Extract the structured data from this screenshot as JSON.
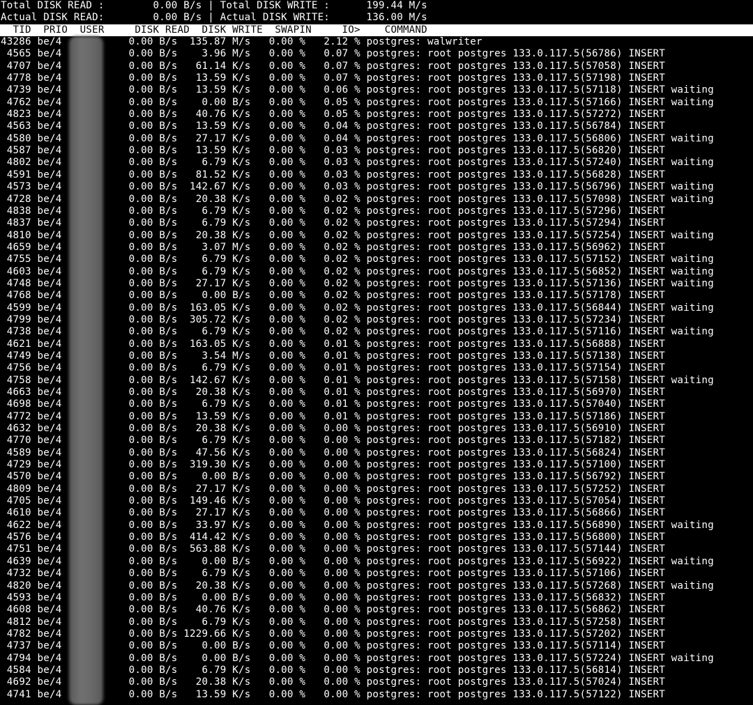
{
  "summary": {
    "total_line": "Total DISK READ :        0.00 B/s | Total DISK WRITE :      199.44 M/s",
    "actual_line": "Actual DISK READ:        0.00 B/s | Actual DISK WRITE:      136.00 M/s"
  },
  "columns": {
    "header_line": "  TID  PRIO  USER     DISK READ  DISK WRITE  SWAPIN     IO>    COMMAND"
  },
  "rows": [
    {
      "tid": "43286",
      "prio": "be/4",
      "read": "0.00 B/s",
      "write": "135.87 M/s",
      "swapin": "0.00 %",
      "io": "2.12 %",
      "cmd": "postgres: walwriter"
    },
    {
      "tid": "4565",
      "prio": "be/4",
      "read": "0.00 B/s",
      "write": "3.96 M/s",
      "swapin": "0.00 %",
      "io": "0.07 %",
      "cmd": "postgres: root postgres 133.0.117.5(56786) INSERT"
    },
    {
      "tid": "4707",
      "prio": "be/4",
      "read": "0.00 B/s",
      "write": "61.14 K/s",
      "swapin": "0.00 %",
      "io": "0.07 %",
      "cmd": "postgres: root postgres 133.0.117.5(57058) INSERT"
    },
    {
      "tid": "4778",
      "prio": "be/4",
      "read": "0.00 B/s",
      "write": "13.59 K/s",
      "swapin": "0.00 %",
      "io": "0.07 %",
      "cmd": "postgres: root postgres 133.0.117.5(57198) INSERT"
    },
    {
      "tid": "4739",
      "prio": "be/4",
      "read": "0.00 B/s",
      "write": "13.59 K/s",
      "swapin": "0.00 %",
      "io": "0.06 %",
      "cmd": "postgres: root postgres 133.0.117.5(57118) INSERT waiting"
    },
    {
      "tid": "4762",
      "prio": "be/4",
      "read": "0.00 B/s",
      "write": "0.00 B/s",
      "swapin": "0.00 %",
      "io": "0.05 %",
      "cmd": "postgres: root postgres 133.0.117.5(57166) INSERT waiting"
    },
    {
      "tid": "4823",
      "prio": "be/4",
      "read": "0.00 B/s",
      "write": "40.76 K/s",
      "swapin": "0.00 %",
      "io": "0.05 %",
      "cmd": "postgres: root postgres 133.0.117.5(57272) INSERT"
    },
    {
      "tid": "4563",
      "prio": "be/4",
      "read": "0.00 B/s",
      "write": "13.59 K/s",
      "swapin": "0.00 %",
      "io": "0.04 %",
      "cmd": "postgres: root postgres 133.0.117.5(56784) INSERT"
    },
    {
      "tid": "4580",
      "prio": "be/4",
      "read": "0.00 B/s",
      "write": "27.17 K/s",
      "swapin": "0.00 %",
      "io": "0.04 %",
      "cmd": "postgres: root postgres 133.0.117.5(56806) INSERT waiting"
    },
    {
      "tid": "4587",
      "prio": "be/4",
      "read": "0.00 B/s",
      "write": "13.59 K/s",
      "swapin": "0.00 %",
      "io": "0.03 %",
      "cmd": "postgres: root postgres 133.0.117.5(56820) INSERT"
    },
    {
      "tid": "4802",
      "prio": "be/4",
      "read": "0.00 B/s",
      "write": "6.79 K/s",
      "swapin": "0.00 %",
      "io": "0.03 %",
      "cmd": "postgres: root postgres 133.0.117.5(57240) INSERT waiting"
    },
    {
      "tid": "4591",
      "prio": "be/4",
      "read": "0.00 B/s",
      "write": "81.52 K/s",
      "swapin": "0.00 %",
      "io": "0.03 %",
      "cmd": "postgres: root postgres 133.0.117.5(56828) INSERT"
    },
    {
      "tid": "4573",
      "prio": "be/4",
      "read": "0.00 B/s",
      "write": "142.67 K/s",
      "swapin": "0.00 %",
      "io": "0.03 %",
      "cmd": "postgres: root postgres 133.0.117.5(56796) INSERT waiting"
    },
    {
      "tid": "4728",
      "prio": "be/4",
      "read": "0.00 B/s",
      "write": "20.38 K/s",
      "swapin": "0.00 %",
      "io": "0.02 %",
      "cmd": "postgres: root postgres 133.0.117.5(57098) INSERT waiting"
    },
    {
      "tid": "4838",
      "prio": "be/4",
      "read": "0.00 B/s",
      "write": "6.79 K/s",
      "swapin": "0.00 %",
      "io": "0.02 %",
      "cmd": "postgres: root postgres 133.0.117.5(57296) INSERT"
    },
    {
      "tid": "4837",
      "prio": "be/4",
      "read": "0.00 B/s",
      "write": "6.79 K/s",
      "swapin": "0.00 %",
      "io": "0.02 %",
      "cmd": "postgres: root postgres 133.0.117.5(57294) INSERT"
    },
    {
      "tid": "4810",
      "prio": "be/4",
      "read": "0.00 B/s",
      "write": "20.38 K/s",
      "swapin": "0.00 %",
      "io": "0.02 %",
      "cmd": "postgres: root postgres 133.0.117.5(57254) INSERT waiting"
    },
    {
      "tid": "4659",
      "prio": "be/4",
      "read": "0.00 B/s",
      "write": "3.07 M/s",
      "swapin": "0.00 %",
      "io": "0.02 %",
      "cmd": "postgres: root postgres 133.0.117.5(56962) INSERT"
    },
    {
      "tid": "4755",
      "prio": "be/4",
      "read": "0.00 B/s",
      "write": "6.79 K/s",
      "swapin": "0.00 %",
      "io": "0.02 %",
      "cmd": "postgres: root postgres 133.0.117.5(57152) INSERT waiting"
    },
    {
      "tid": "4603",
      "prio": "be/4",
      "read": "0.00 B/s",
      "write": "6.79 K/s",
      "swapin": "0.00 %",
      "io": "0.02 %",
      "cmd": "postgres: root postgres 133.0.117.5(56852) INSERT waiting"
    },
    {
      "tid": "4748",
      "prio": "be/4",
      "read": "0.00 B/s",
      "write": "27.17 K/s",
      "swapin": "0.00 %",
      "io": "0.02 %",
      "cmd": "postgres: root postgres 133.0.117.5(57136) INSERT waiting"
    },
    {
      "tid": "4768",
      "prio": "be/4",
      "read": "0.00 B/s",
      "write": "0.00 B/s",
      "swapin": "0.00 %",
      "io": "0.02 %",
      "cmd": "postgres: root postgres 133.0.117.5(57178) INSERT"
    },
    {
      "tid": "4599",
      "prio": "be/4",
      "read": "0.00 B/s",
      "write": "163.05 K/s",
      "swapin": "0.00 %",
      "io": "0.02 %",
      "cmd": "postgres: root postgres 133.0.117.5(56844) INSERT waiting"
    },
    {
      "tid": "4799",
      "prio": "be/4",
      "read": "0.00 B/s",
      "write": "305.72 K/s",
      "swapin": "0.00 %",
      "io": "0.02 %",
      "cmd": "postgres: root postgres 133.0.117.5(57234) INSERT"
    },
    {
      "tid": "4738",
      "prio": "be/4",
      "read": "0.00 B/s",
      "write": "6.79 K/s",
      "swapin": "0.00 %",
      "io": "0.02 %",
      "cmd": "postgres: root postgres 133.0.117.5(57116) INSERT waiting"
    },
    {
      "tid": "4621",
      "prio": "be/4",
      "read": "0.00 B/s",
      "write": "163.05 K/s",
      "swapin": "0.00 %",
      "io": "0.01 %",
      "cmd": "postgres: root postgres 133.0.117.5(56888) INSERT"
    },
    {
      "tid": "4749",
      "prio": "be/4",
      "read": "0.00 B/s",
      "write": "3.54 M/s",
      "swapin": "0.00 %",
      "io": "0.01 %",
      "cmd": "postgres: root postgres 133.0.117.5(57138) INSERT"
    },
    {
      "tid": "4756",
      "prio": "be/4",
      "read": "0.00 B/s",
      "write": "6.79 K/s",
      "swapin": "0.00 %",
      "io": "0.01 %",
      "cmd": "postgres: root postgres 133.0.117.5(57154) INSERT"
    },
    {
      "tid": "4758",
      "prio": "be/4",
      "read": "0.00 B/s",
      "write": "142.67 K/s",
      "swapin": "0.00 %",
      "io": "0.01 %",
      "cmd": "postgres: root postgres 133.0.117.5(57158) INSERT waiting"
    },
    {
      "tid": "4663",
      "prio": "be/4",
      "read": "0.00 B/s",
      "write": "20.38 K/s",
      "swapin": "0.00 %",
      "io": "0.01 %",
      "cmd": "postgres: root postgres 133.0.117.5(56970) INSERT"
    },
    {
      "tid": "4698",
      "prio": "be/4",
      "read": "0.00 B/s",
      "write": "6.79 K/s",
      "swapin": "0.00 %",
      "io": "0.01 %",
      "cmd": "postgres: root postgres 133.0.117.5(57040) INSERT"
    },
    {
      "tid": "4772",
      "prio": "be/4",
      "read": "0.00 B/s",
      "write": "13.59 K/s",
      "swapin": "0.00 %",
      "io": "0.01 %",
      "cmd": "postgres: root postgres 133.0.117.5(57186) INSERT"
    },
    {
      "tid": "4632",
      "prio": "be/4",
      "read": "0.00 B/s",
      "write": "20.38 K/s",
      "swapin": "0.00 %",
      "io": "0.00 %",
      "cmd": "postgres: root postgres 133.0.117.5(56910) INSERT"
    },
    {
      "tid": "4770",
      "prio": "be/4",
      "read": "0.00 B/s",
      "write": "6.79 K/s",
      "swapin": "0.00 %",
      "io": "0.00 %",
      "cmd": "postgres: root postgres 133.0.117.5(57182) INSERT"
    },
    {
      "tid": "4589",
      "prio": "be/4",
      "read": "0.00 B/s",
      "write": "47.56 K/s",
      "swapin": "0.00 %",
      "io": "0.00 %",
      "cmd": "postgres: root postgres 133.0.117.5(56824) INSERT"
    },
    {
      "tid": "4729",
      "prio": "be/4",
      "read": "0.00 B/s",
      "write": "319.30 K/s",
      "swapin": "0.00 %",
      "io": "0.00 %",
      "cmd": "postgres: root postgres 133.0.117.5(57100) INSERT"
    },
    {
      "tid": "4570",
      "prio": "be/4",
      "read": "0.00 B/s",
      "write": "0.00 B/s",
      "swapin": "0.00 %",
      "io": "0.00 %",
      "cmd": "postgres: root postgres 133.0.117.5(56792) INSERT"
    },
    {
      "tid": "4809",
      "prio": "be/4",
      "read": "0.00 B/s",
      "write": "27.17 K/s",
      "swapin": "0.00 %",
      "io": "0.00 %",
      "cmd": "postgres: root postgres 133.0.117.5(57252) INSERT"
    },
    {
      "tid": "4705",
      "prio": "be/4",
      "read": "0.00 B/s",
      "write": "149.46 K/s",
      "swapin": "0.00 %",
      "io": "0.00 %",
      "cmd": "postgres: root postgres 133.0.117.5(57054) INSERT"
    },
    {
      "tid": "4610",
      "prio": "be/4",
      "read": "0.00 B/s",
      "write": "27.17 K/s",
      "swapin": "0.00 %",
      "io": "0.00 %",
      "cmd": "postgres: root postgres 133.0.117.5(56866) INSERT"
    },
    {
      "tid": "4622",
      "prio": "be/4",
      "read": "0.00 B/s",
      "write": "33.97 K/s",
      "swapin": "0.00 %",
      "io": "0.00 %",
      "cmd": "postgres: root postgres 133.0.117.5(56890) INSERT waiting"
    },
    {
      "tid": "4576",
      "prio": "be/4",
      "read": "0.00 B/s",
      "write": "414.42 K/s",
      "swapin": "0.00 %",
      "io": "0.00 %",
      "cmd": "postgres: root postgres 133.0.117.5(56800) INSERT"
    },
    {
      "tid": "4751",
      "prio": "be/4",
      "read": "0.00 B/s",
      "write": "563.88 K/s",
      "swapin": "0.00 %",
      "io": "0.00 %",
      "cmd": "postgres: root postgres 133.0.117.5(57144) INSERT"
    },
    {
      "tid": "4639",
      "prio": "be/4",
      "read": "0.00 B/s",
      "write": "0.00 B/s",
      "swapin": "0.00 %",
      "io": "0.00 %",
      "cmd": "postgres: root postgres 133.0.117.5(56922) INSERT waiting"
    },
    {
      "tid": "4732",
      "prio": "be/4",
      "read": "0.00 B/s",
      "write": "6.79 K/s",
      "swapin": "0.00 %",
      "io": "0.00 %",
      "cmd": "postgres: root postgres 133.0.117.5(57106) INSERT"
    },
    {
      "tid": "4820",
      "prio": "be/4",
      "read": "0.00 B/s",
      "write": "20.38 K/s",
      "swapin": "0.00 %",
      "io": "0.00 %",
      "cmd": "postgres: root postgres 133.0.117.5(57268) INSERT waiting"
    },
    {
      "tid": "4593",
      "prio": "be/4",
      "read": "0.00 B/s",
      "write": "0.00 B/s",
      "swapin": "0.00 %",
      "io": "0.00 %",
      "cmd": "postgres: root postgres 133.0.117.5(56832) INSERT"
    },
    {
      "tid": "4608",
      "prio": "be/4",
      "read": "0.00 B/s",
      "write": "40.76 K/s",
      "swapin": "0.00 %",
      "io": "0.00 %",
      "cmd": "postgres: root postgres 133.0.117.5(56862) INSERT"
    },
    {
      "tid": "4812",
      "prio": "be/4",
      "read": "0.00 B/s",
      "write": "6.79 K/s",
      "swapin": "0.00 %",
      "io": "0.00 %",
      "cmd": "postgres: root postgres 133.0.117.5(57258) INSERT"
    },
    {
      "tid": "4782",
      "prio": "be/4",
      "read": "0.00 B/s",
      "write": "1229.66 K/s",
      "swapin": "0.00 %",
      "io": "0.00 %",
      "cmd": "postgres: root postgres 133.0.117.5(57202) INSERT"
    },
    {
      "tid": "4737",
      "prio": "be/4",
      "read": "0.00 B/s",
      "write": "0.00 B/s",
      "swapin": "0.00 %",
      "io": "0.00 %",
      "cmd": "postgres: root postgres 133.0.117.5(57114) INSERT"
    },
    {
      "tid": "4794",
      "prio": "be/4",
      "read": "0.00 B/s",
      "write": "0.00 B/s",
      "swapin": "0.00 %",
      "io": "0.00 %",
      "cmd": "postgres: root postgres 133.0.117.5(57224) INSERT waiting"
    },
    {
      "tid": "4584",
      "prio": "be/4",
      "read": "0.00 B/s",
      "write": "6.79 K/s",
      "swapin": "0.00 %",
      "io": "0.00 %",
      "cmd": "postgres: root postgres 133.0.117.5(56814) INSERT"
    },
    {
      "tid": "4692",
      "prio": "be/4",
      "read": "0.00 B/s",
      "write": "20.38 K/s",
      "swapin": "0.00 %",
      "io": "0.00 %",
      "cmd": "postgres: root postgres 133.0.117.5(57024) INSERT"
    },
    {
      "tid": "4741",
      "prio": "be/4",
      "read": "0.00 B/s",
      "write": "13.59 K/s",
      "swapin": "0.00 %",
      "io": "0.00 %",
      "cmd": "postgres: root postgres 133.0.117.5(57122) INSERT"
    }
  ]
}
